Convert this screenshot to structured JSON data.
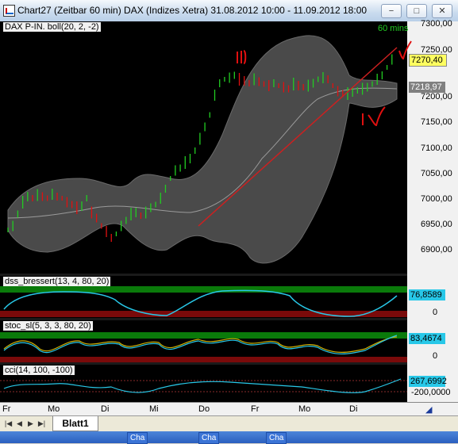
{
  "window": {
    "title": "Chart27 (Zeitbar 60 min)  DAX (Indizes Xetra) 31.08.2012 10:00 - 11.09.2012 18:00",
    "buttons": [
      "−",
      "□",
      "✕"
    ]
  },
  "main_pane": {
    "label": "DAX P-IN. boll(20, 2, -2)",
    "interval": "60 mins",
    "price_ticks": [
      "7300,00",
      "7250,00",
      "7200,00",
      "7150,00",
      "7100,00",
      "7050,00",
      "7000,00",
      "6950,00",
      "6900,00"
    ],
    "last_price": "7270,40",
    "mid_price": "7218,97",
    "annotations": [
      "III",
      "IV",
      "V"
    ]
  },
  "dss_pane": {
    "label": "dss_bressert(13, 4, 80, 20)",
    "value": "76,8589",
    "ticks": [
      "0"
    ]
  },
  "stoc_pane": {
    "label": "stoc_sl(5, 3, 3, 80, 20)",
    "value": "83,4674",
    "ticks": [
      "0"
    ]
  },
  "cci_pane": {
    "label": "cci(14, 100, -100)",
    "value": "267,6992",
    "ticks": [
      "-200,0000"
    ]
  },
  "x_axis": [
    "Fr",
    "Mo",
    "Di",
    "Mi",
    "Do",
    "Fr",
    "Mo",
    "Di"
  ],
  "sheet_tabs": [
    "Blatt1"
  ],
  "taskbar": [
    "Cha",
    "Cha",
    "Cha"
  ],
  "colors": {
    "up": "#22cc22",
    "down": "#e01010",
    "band": "#505050",
    "trend": "#cc2020",
    "osc_line": "#28c8e8"
  }
}
